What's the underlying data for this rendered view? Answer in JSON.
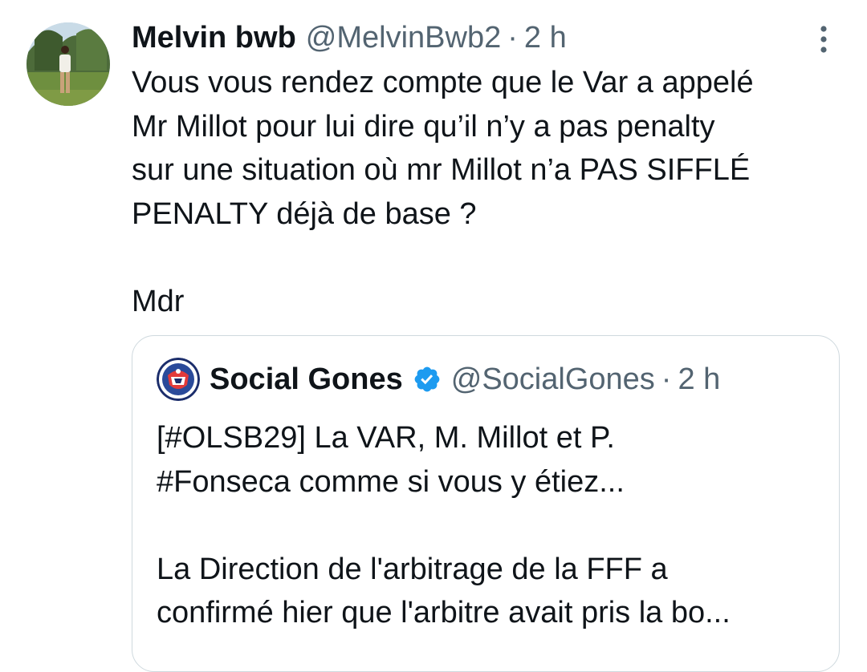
{
  "tweet": {
    "author_name": "Melvin bwb",
    "handle": "@MelvinBwb2",
    "separator": "·",
    "time": "2 h",
    "text": "Vous vous rendez compte que le Var a appelé\nMr Millot pour lui dire qu’il n’y a pas penalty\nsur une situation où mr Millot n’a PAS SIFFLÉ\nPENALTY déjà de base  ?\n\nMdr"
  },
  "quote": {
    "author_name": "Social Gones",
    "verified": true,
    "handle": "@SocialGones",
    "separator": "·",
    "time": "2 h",
    "text": "[#OLSB29] La VAR, M. Millot et P.\n#Fonseca comme si vous y étiez...\n\nLa Direction de l'arbitrage de la FFF a\nconfirmé hier que l'arbitre avait pris la bo..."
  },
  "icons": {
    "more": "more-vertical-icon",
    "verified": "verified-badge-icon"
  },
  "colors": {
    "text": "#0f1419",
    "secondary": "#536471",
    "verified": "#1d9bf0",
    "border": "#cfd9de"
  }
}
